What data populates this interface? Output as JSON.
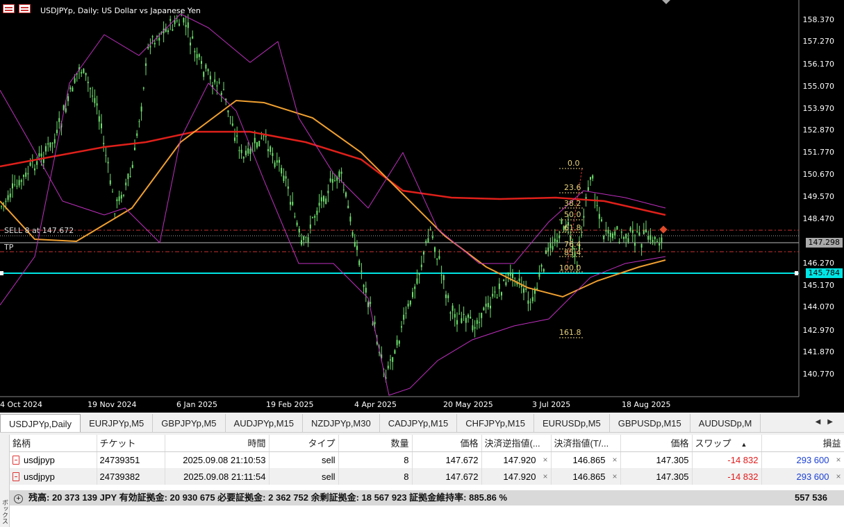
{
  "chart": {
    "title": "USDJPYp, Daily:  US Dollar vs Japanese Yen",
    "price_labels": [
      "158.370",
      "157.270",
      "156.170",
      "155.070",
      "153.970",
      "152.870",
      "151.770",
      "150.670",
      "149.570",
      "148.470",
      "146.270",
      "145.170",
      "144.070",
      "142.970",
      "141.870",
      "140.770"
    ],
    "date_labels": [
      "4 Oct 2024",
      "19 Nov 2024",
      "6 Jan 2025",
      "19 Feb 2025",
      "4 Apr 2025",
      "20 May 2025",
      "3 Jul 2025",
      "18 Aug 2025"
    ],
    "current_price": "147.298",
    "cyan_line_price": "145.784",
    "sell_line_label": "SELL 8 at 147.672",
    "tp_label": "TP",
    "fib_levels": [
      "0.0",
      "23.6",
      "38.2",
      "50.0",
      "61.8",
      "76.4",
      "85.4",
      "100.0",
      "161.8"
    ],
    "colors": {
      "background": "#000000",
      "candle": "#6fe06f",
      "ma_long": "#e0201a",
      "ma_mid": "#f0a030",
      "bands": "#c030c0",
      "cyan_line": "#00e5e5"
    }
  },
  "tabs": [
    {
      "label": "USDJPYp,Daily",
      "active": true
    },
    {
      "label": "EURJPYp,M5"
    },
    {
      "label": "GBPJPYp,M5"
    },
    {
      "label": "AUDJPYp,M15"
    },
    {
      "label": "NZDJPYp,M30"
    },
    {
      "label": "CADJPYp,M15"
    },
    {
      "label": "CHFJPYp,M15"
    },
    {
      "label": "EURUSDp,M5"
    },
    {
      "label": "GBPUSDp,M15"
    },
    {
      "label": "AUDUSDp,M"
    }
  ],
  "table": {
    "headers": [
      "銘柄",
      "チケット",
      "時間",
      "タイプ",
      "数量",
      "価格",
      "決済逆指値(...",
      "決済指値(T/...",
      "価格",
      "スワップ",
      "損益"
    ],
    "rows": [
      {
        "symbol": "usdjpyp",
        "ticket": "24739351",
        "time": "2025.09.08 21:10:53",
        "type": "sell",
        "volume": "8",
        "open_price": "147.672",
        "sl": "147.920",
        "tp": "146.865",
        "price": "147.305",
        "swap": "-14 832",
        "profit": "293 600"
      },
      {
        "symbol": "usdjpyp",
        "ticket": "24739382",
        "time": "2025.09.08 21:11:54",
        "type": "sell",
        "volume": "8",
        "open_price": "147.672",
        "sl": "147.920",
        "tp": "146.865",
        "price": "147.305",
        "swap": "-14 832",
        "profit": "293 600"
      }
    ],
    "close_glyph": "×",
    "sort_glyph": "▲"
  },
  "summary": {
    "text": "残高: 20 373 139 JPY  有効証拠金: 20 930 675  必要証拠金: 2 362 752  余剰証拠金: 18 567 923  証拠金維持率: 885.86 %",
    "total": "557 536"
  },
  "side_label": "ボックス"
}
